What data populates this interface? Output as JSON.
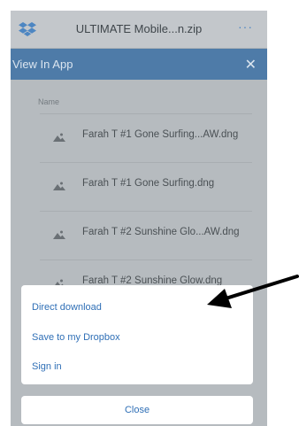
{
  "topbar": {
    "title": "ULTIMATE Mobile...n.zip",
    "more_label": "···",
    "logo_icon": "dropbox-logo-icon"
  },
  "banner": {
    "label": "View In App",
    "close_label": "✕"
  },
  "file_list": {
    "header": "Name",
    "items": [
      {
        "name": "Farah T #1 Gone Surfing...AW.dng",
        "icon": "image-file-icon"
      },
      {
        "name": "Farah T #1 Gone Surfing.dng",
        "icon": "image-file-icon"
      },
      {
        "name": "Farah T #2 Sunshine Glo...AW.dng",
        "icon": "image-file-icon"
      },
      {
        "name": "Farah T #2 Sunshine Glow.dng",
        "icon": "image-file-icon"
      }
    ]
  },
  "action_sheet": {
    "options": [
      "Direct download",
      "Save to my Dropbox",
      "Sign in"
    ],
    "close_label": "Close"
  },
  "annotation": {
    "icon": "pointer-arrow-icon"
  },
  "colors": {
    "accent": "#2f6fb6",
    "banner": "#4e7ba8",
    "overlay": "#b6bbbf"
  }
}
